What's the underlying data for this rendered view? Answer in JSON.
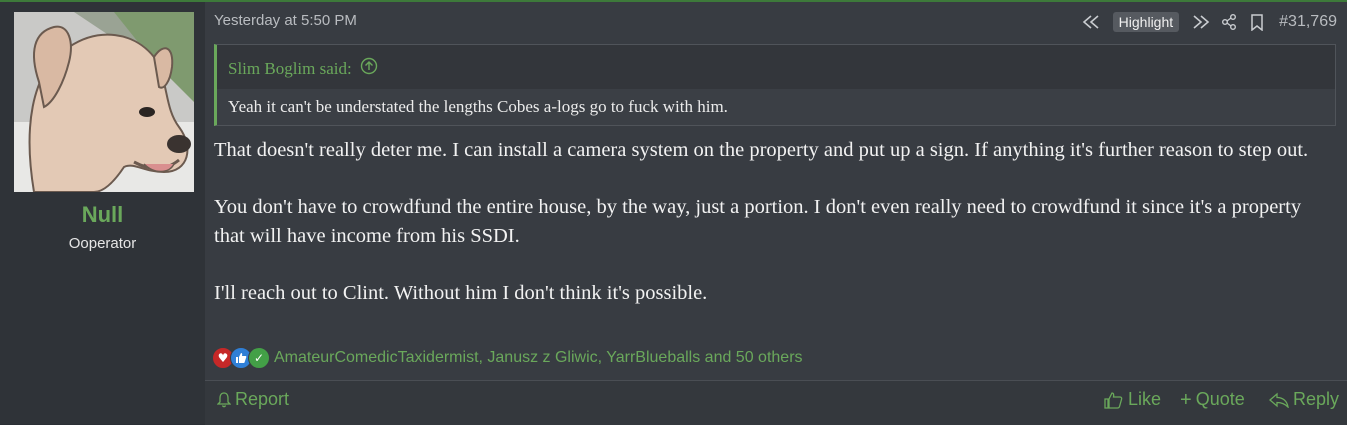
{
  "post": {
    "author": {
      "name": "Null",
      "title": "Ooperator"
    },
    "date": "Yesterday at 5:50 PM",
    "highlight_label": "Highlight",
    "post_number": "#31,769",
    "quote": {
      "header": "Slim Boglim said:",
      "text": "Yeah it can't be understated the lengths Cobes a-logs go to fuck with him."
    },
    "body": [
      "That doesn't really deter me. I can install a camera system on the property and put up a sign. If anything it's further reason to step out.",
      "You don't have to crowdfund the entire house, by the way, just a portion. I don't even really need to crowdfund it since it's a property that will have income from his SSDI.",
      "I'll reach out to Clint. Without him I don't think it's possible."
    ],
    "reactions": {
      "icons": [
        "heart-icon",
        "thumbs-up-icon",
        "check-icon"
      ],
      "list_text": "AmateurComedicTaxidermist, Janusz z Gliwic, YarrBlueballs and 50 others"
    },
    "footer": {
      "report": "Report",
      "like": "Like",
      "quote": "Quote",
      "reply": "Reply"
    }
  },
  "colors": {
    "accent": "#6aa85b",
    "background": "#383c42",
    "user_column": "#2f3338"
  }
}
